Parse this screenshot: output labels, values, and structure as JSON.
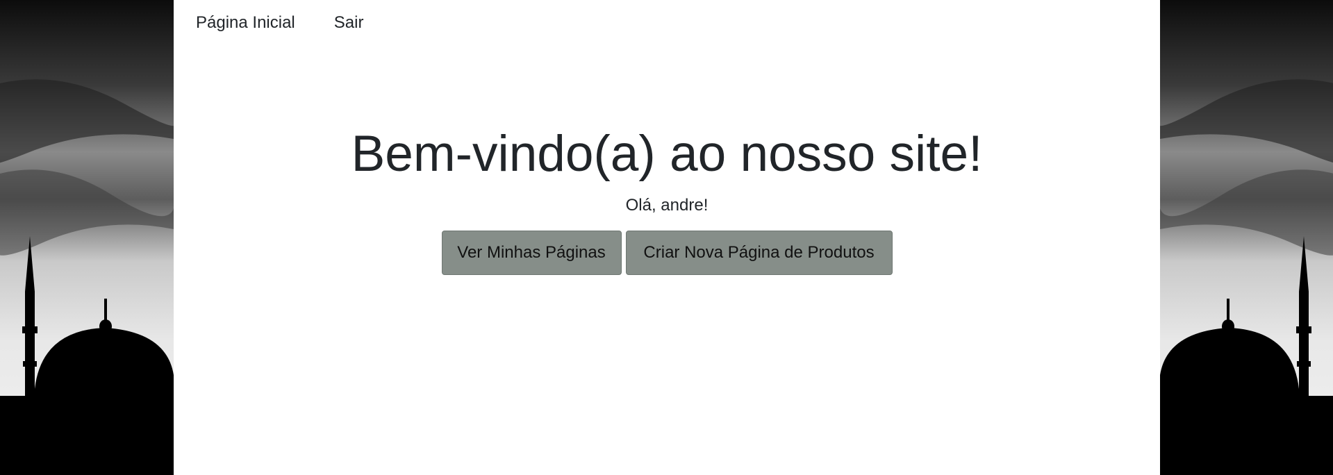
{
  "nav": {
    "home_label": "Página Inicial",
    "logout_label": "Sair"
  },
  "hero": {
    "title": "Bem-vindo(a) ao nosso site!",
    "greeting": "Olá, andre!"
  },
  "actions": {
    "view_pages_label": "Ver Minhas Páginas",
    "create_page_label": "Criar Nova Página de Produtos"
  },
  "colors": {
    "button_bg": "#868e89",
    "content_bg": "#ffffff",
    "text": "#212529"
  },
  "icons": {
    "side_background": "mosque-silhouette"
  }
}
